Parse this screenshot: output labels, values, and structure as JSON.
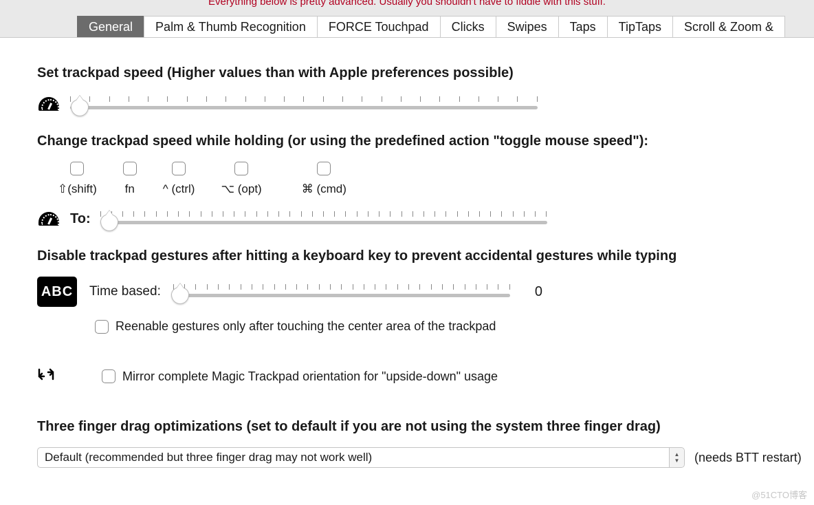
{
  "advanced_note": "Everything below is pretty advanced. Usually you shouldn't have to fiddle with this stuff.",
  "tabs": [
    {
      "label": "General",
      "active": true
    },
    {
      "label": "Palm & Thumb Recognition",
      "active": false
    },
    {
      "label": "FORCE Touchpad",
      "active": false
    },
    {
      "label": "Clicks",
      "active": false
    },
    {
      "label": "Swipes",
      "active": false
    },
    {
      "label": "Taps",
      "active": false
    },
    {
      "label": "TipTaps",
      "active": false
    },
    {
      "label": "Scroll & Zoom &",
      "active": false
    }
  ],
  "speed": {
    "heading": "Set trackpad speed (Higher values than with Apple preferences possible)",
    "slider": {
      "ticks": 25,
      "value_pct": 2
    }
  },
  "modifier_speed": {
    "heading": "Change trackpad speed while holding (or using the predefined action \"toggle mouse speed\"):",
    "modifiers": [
      {
        "key": "shift",
        "label": "⇧(shift)",
        "checked": false
      },
      {
        "key": "fn",
        "label": "fn",
        "checked": false
      },
      {
        "key": "ctrl",
        "label": "^ (ctrl)",
        "checked": false
      },
      {
        "key": "opt",
        "label": "⌥ (opt)",
        "checked": false
      },
      {
        "key": "cmd",
        "label": "⌘ (cmd)",
        "checked": false
      }
    ],
    "to_label": "To:",
    "slider": {
      "ticks": 41,
      "value_pct": 2
    }
  },
  "disable_gestures": {
    "heading": "Disable trackpad gestures after hitting a keyboard key to prevent accidental gestures while typing",
    "time_label": "Time based:",
    "slider": {
      "ticks": 31,
      "value_pct": 2
    },
    "value_display": "0",
    "reenable_label": "Reenable gestures only after touching the center area of the trackpad",
    "reenable_checked": false,
    "abc": "ABC"
  },
  "mirror": {
    "label": "Mirror complete Magic Trackpad orientation for \"upside-down\" usage",
    "checked": false
  },
  "three_finger": {
    "heading": "Three finger drag optimizations (set to default if you are not using the system three finger drag)",
    "selected": "Default (recommended but three finger drag may not work well)",
    "restart_note": "(needs BTT restart)"
  },
  "watermark": "@51CTO博客"
}
